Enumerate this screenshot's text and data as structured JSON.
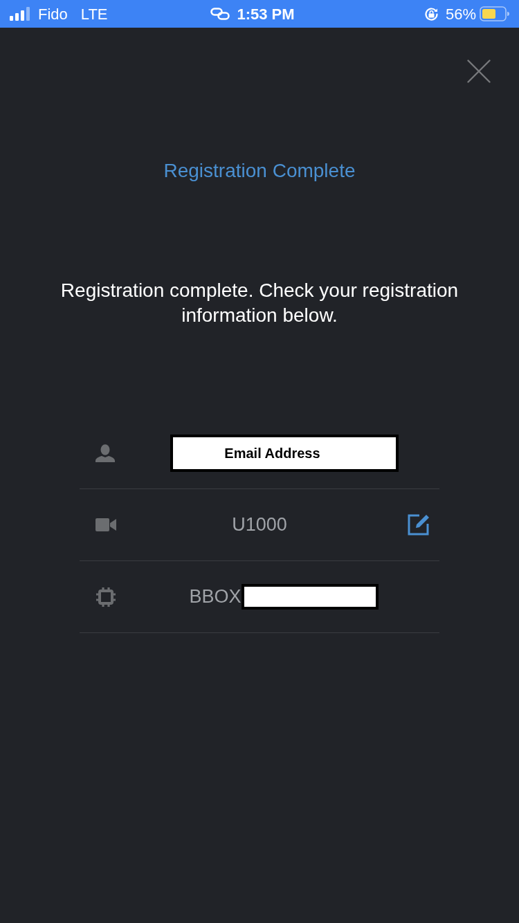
{
  "status_bar": {
    "carrier": "Fido",
    "network": "LTE",
    "time": "1:53 PM",
    "battery": "56%"
  },
  "dialog": {
    "title": "Registration Complete",
    "message": "Registration complete. Check your registration information below."
  },
  "rows": [
    {
      "kind": "user",
      "value": "Email Address",
      "masked": true,
      "masked_suffix": false,
      "editable": false
    },
    {
      "kind": "camera",
      "value": "U1000",
      "masked": false,
      "masked_suffix": false,
      "editable": true
    },
    {
      "kind": "chip",
      "value": "BBOX",
      "masked": false,
      "masked_suffix": true,
      "editable": false
    }
  ]
}
